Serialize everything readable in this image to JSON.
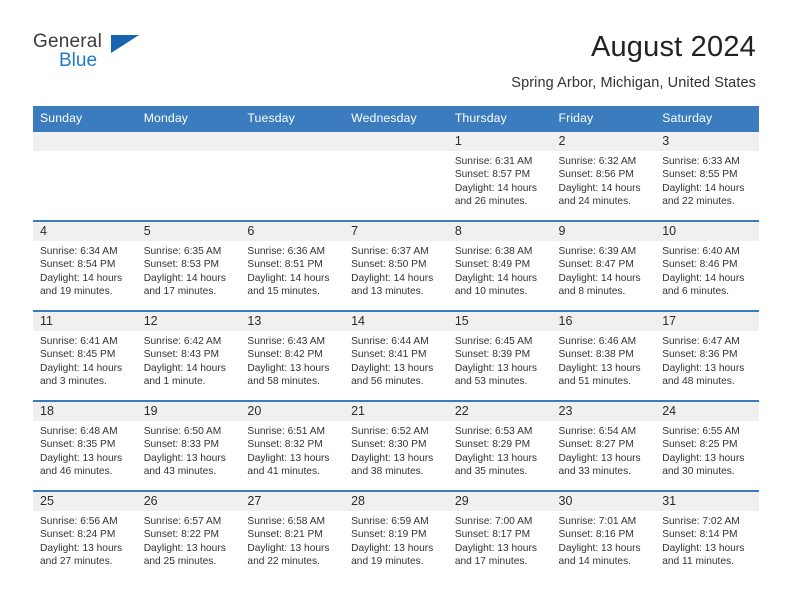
{
  "brand": {
    "name_top": "General",
    "name_bottom": "Blue",
    "triangle_color": "#1565b0",
    "blue_text_color": "#2179c7"
  },
  "header": {
    "title": "August 2024",
    "subtitle": "Spring Arbor, Michigan, United States",
    "header_bg": "#3a7cbe",
    "daynum_bg": "#f0f0f0"
  },
  "weekday_headers": [
    "Sunday",
    "Monday",
    "Tuesday",
    "Wednesday",
    "Thursday",
    "Friday",
    "Saturday"
  ],
  "labels": {
    "sunrise_prefix": "Sunrise:",
    "sunset_prefix": "Sunset:",
    "daylight_prefix": "Daylight:"
  },
  "weeks": [
    [
      {
        "day": "",
        "sunrise": "",
        "sunset": "",
        "daylight_line1": "",
        "daylight_line2": ""
      },
      {
        "day": "",
        "sunrise": "",
        "sunset": "",
        "daylight_line1": "",
        "daylight_line2": ""
      },
      {
        "day": "",
        "sunrise": "",
        "sunset": "",
        "daylight_line1": "",
        "daylight_line2": ""
      },
      {
        "day": "",
        "sunrise": "",
        "sunset": "",
        "daylight_line1": "",
        "daylight_line2": ""
      },
      {
        "day": "1",
        "sunrise": "Sunrise: 6:31 AM",
        "sunset": "Sunset: 8:57 PM",
        "daylight_line1": "Daylight: 14 hours",
        "daylight_line2": "and 26 minutes."
      },
      {
        "day": "2",
        "sunrise": "Sunrise: 6:32 AM",
        "sunset": "Sunset: 8:56 PM",
        "daylight_line1": "Daylight: 14 hours",
        "daylight_line2": "and 24 minutes."
      },
      {
        "day": "3",
        "sunrise": "Sunrise: 6:33 AM",
        "sunset": "Sunset: 8:55 PM",
        "daylight_line1": "Daylight: 14 hours",
        "daylight_line2": "and 22 minutes."
      }
    ],
    [
      {
        "day": "4",
        "sunrise": "Sunrise: 6:34 AM",
        "sunset": "Sunset: 8:54 PM",
        "daylight_line1": "Daylight: 14 hours",
        "daylight_line2": "and 19 minutes."
      },
      {
        "day": "5",
        "sunrise": "Sunrise: 6:35 AM",
        "sunset": "Sunset: 8:53 PM",
        "daylight_line1": "Daylight: 14 hours",
        "daylight_line2": "and 17 minutes."
      },
      {
        "day": "6",
        "sunrise": "Sunrise: 6:36 AM",
        "sunset": "Sunset: 8:51 PM",
        "daylight_line1": "Daylight: 14 hours",
        "daylight_line2": "and 15 minutes."
      },
      {
        "day": "7",
        "sunrise": "Sunrise: 6:37 AM",
        "sunset": "Sunset: 8:50 PM",
        "daylight_line1": "Daylight: 14 hours",
        "daylight_line2": "and 13 minutes."
      },
      {
        "day": "8",
        "sunrise": "Sunrise: 6:38 AM",
        "sunset": "Sunset: 8:49 PM",
        "daylight_line1": "Daylight: 14 hours",
        "daylight_line2": "and 10 minutes."
      },
      {
        "day": "9",
        "sunrise": "Sunrise: 6:39 AM",
        "sunset": "Sunset: 8:47 PM",
        "daylight_line1": "Daylight: 14 hours",
        "daylight_line2": "and 8 minutes."
      },
      {
        "day": "10",
        "sunrise": "Sunrise: 6:40 AM",
        "sunset": "Sunset: 8:46 PM",
        "daylight_line1": "Daylight: 14 hours",
        "daylight_line2": "and 6 minutes."
      }
    ],
    [
      {
        "day": "11",
        "sunrise": "Sunrise: 6:41 AM",
        "sunset": "Sunset: 8:45 PM",
        "daylight_line1": "Daylight: 14 hours",
        "daylight_line2": "and 3 minutes."
      },
      {
        "day": "12",
        "sunrise": "Sunrise: 6:42 AM",
        "sunset": "Sunset: 8:43 PM",
        "daylight_line1": "Daylight: 14 hours",
        "daylight_line2": "and 1 minute."
      },
      {
        "day": "13",
        "sunrise": "Sunrise: 6:43 AM",
        "sunset": "Sunset: 8:42 PM",
        "daylight_line1": "Daylight: 13 hours",
        "daylight_line2": "and 58 minutes."
      },
      {
        "day": "14",
        "sunrise": "Sunrise: 6:44 AM",
        "sunset": "Sunset: 8:41 PM",
        "daylight_line1": "Daylight: 13 hours",
        "daylight_line2": "and 56 minutes."
      },
      {
        "day": "15",
        "sunrise": "Sunrise: 6:45 AM",
        "sunset": "Sunset: 8:39 PM",
        "daylight_line1": "Daylight: 13 hours",
        "daylight_line2": "and 53 minutes."
      },
      {
        "day": "16",
        "sunrise": "Sunrise: 6:46 AM",
        "sunset": "Sunset: 8:38 PM",
        "daylight_line1": "Daylight: 13 hours",
        "daylight_line2": "and 51 minutes."
      },
      {
        "day": "17",
        "sunrise": "Sunrise: 6:47 AM",
        "sunset": "Sunset: 8:36 PM",
        "daylight_line1": "Daylight: 13 hours",
        "daylight_line2": "and 48 minutes."
      }
    ],
    [
      {
        "day": "18",
        "sunrise": "Sunrise: 6:48 AM",
        "sunset": "Sunset: 8:35 PM",
        "daylight_line1": "Daylight: 13 hours",
        "daylight_line2": "and 46 minutes."
      },
      {
        "day": "19",
        "sunrise": "Sunrise: 6:50 AM",
        "sunset": "Sunset: 8:33 PM",
        "daylight_line1": "Daylight: 13 hours",
        "daylight_line2": "and 43 minutes."
      },
      {
        "day": "20",
        "sunrise": "Sunrise: 6:51 AM",
        "sunset": "Sunset: 8:32 PM",
        "daylight_line1": "Daylight: 13 hours",
        "daylight_line2": "and 41 minutes."
      },
      {
        "day": "21",
        "sunrise": "Sunrise: 6:52 AM",
        "sunset": "Sunset: 8:30 PM",
        "daylight_line1": "Daylight: 13 hours",
        "daylight_line2": "and 38 minutes."
      },
      {
        "day": "22",
        "sunrise": "Sunrise: 6:53 AM",
        "sunset": "Sunset: 8:29 PM",
        "daylight_line1": "Daylight: 13 hours",
        "daylight_line2": "and 35 minutes."
      },
      {
        "day": "23",
        "sunrise": "Sunrise: 6:54 AM",
        "sunset": "Sunset: 8:27 PM",
        "daylight_line1": "Daylight: 13 hours",
        "daylight_line2": "and 33 minutes."
      },
      {
        "day": "24",
        "sunrise": "Sunrise: 6:55 AM",
        "sunset": "Sunset: 8:25 PM",
        "daylight_line1": "Daylight: 13 hours",
        "daylight_line2": "and 30 minutes."
      }
    ],
    [
      {
        "day": "25",
        "sunrise": "Sunrise: 6:56 AM",
        "sunset": "Sunset: 8:24 PM",
        "daylight_line1": "Daylight: 13 hours",
        "daylight_line2": "and 27 minutes."
      },
      {
        "day": "26",
        "sunrise": "Sunrise: 6:57 AM",
        "sunset": "Sunset: 8:22 PM",
        "daylight_line1": "Daylight: 13 hours",
        "daylight_line2": "and 25 minutes."
      },
      {
        "day": "27",
        "sunrise": "Sunrise: 6:58 AM",
        "sunset": "Sunset: 8:21 PM",
        "daylight_line1": "Daylight: 13 hours",
        "daylight_line2": "and 22 minutes."
      },
      {
        "day": "28",
        "sunrise": "Sunrise: 6:59 AM",
        "sunset": "Sunset: 8:19 PM",
        "daylight_line1": "Daylight: 13 hours",
        "daylight_line2": "and 19 minutes."
      },
      {
        "day": "29",
        "sunrise": "Sunrise: 7:00 AM",
        "sunset": "Sunset: 8:17 PM",
        "daylight_line1": "Daylight: 13 hours",
        "daylight_line2": "and 17 minutes."
      },
      {
        "day": "30",
        "sunrise": "Sunrise: 7:01 AM",
        "sunset": "Sunset: 8:16 PM",
        "daylight_line1": "Daylight: 13 hours",
        "daylight_line2": "and 14 minutes."
      },
      {
        "day": "31",
        "sunrise": "Sunrise: 7:02 AM",
        "sunset": "Sunset: 8:14 PM",
        "daylight_line1": "Daylight: 13 hours",
        "daylight_line2": "and 11 minutes."
      }
    ]
  ]
}
